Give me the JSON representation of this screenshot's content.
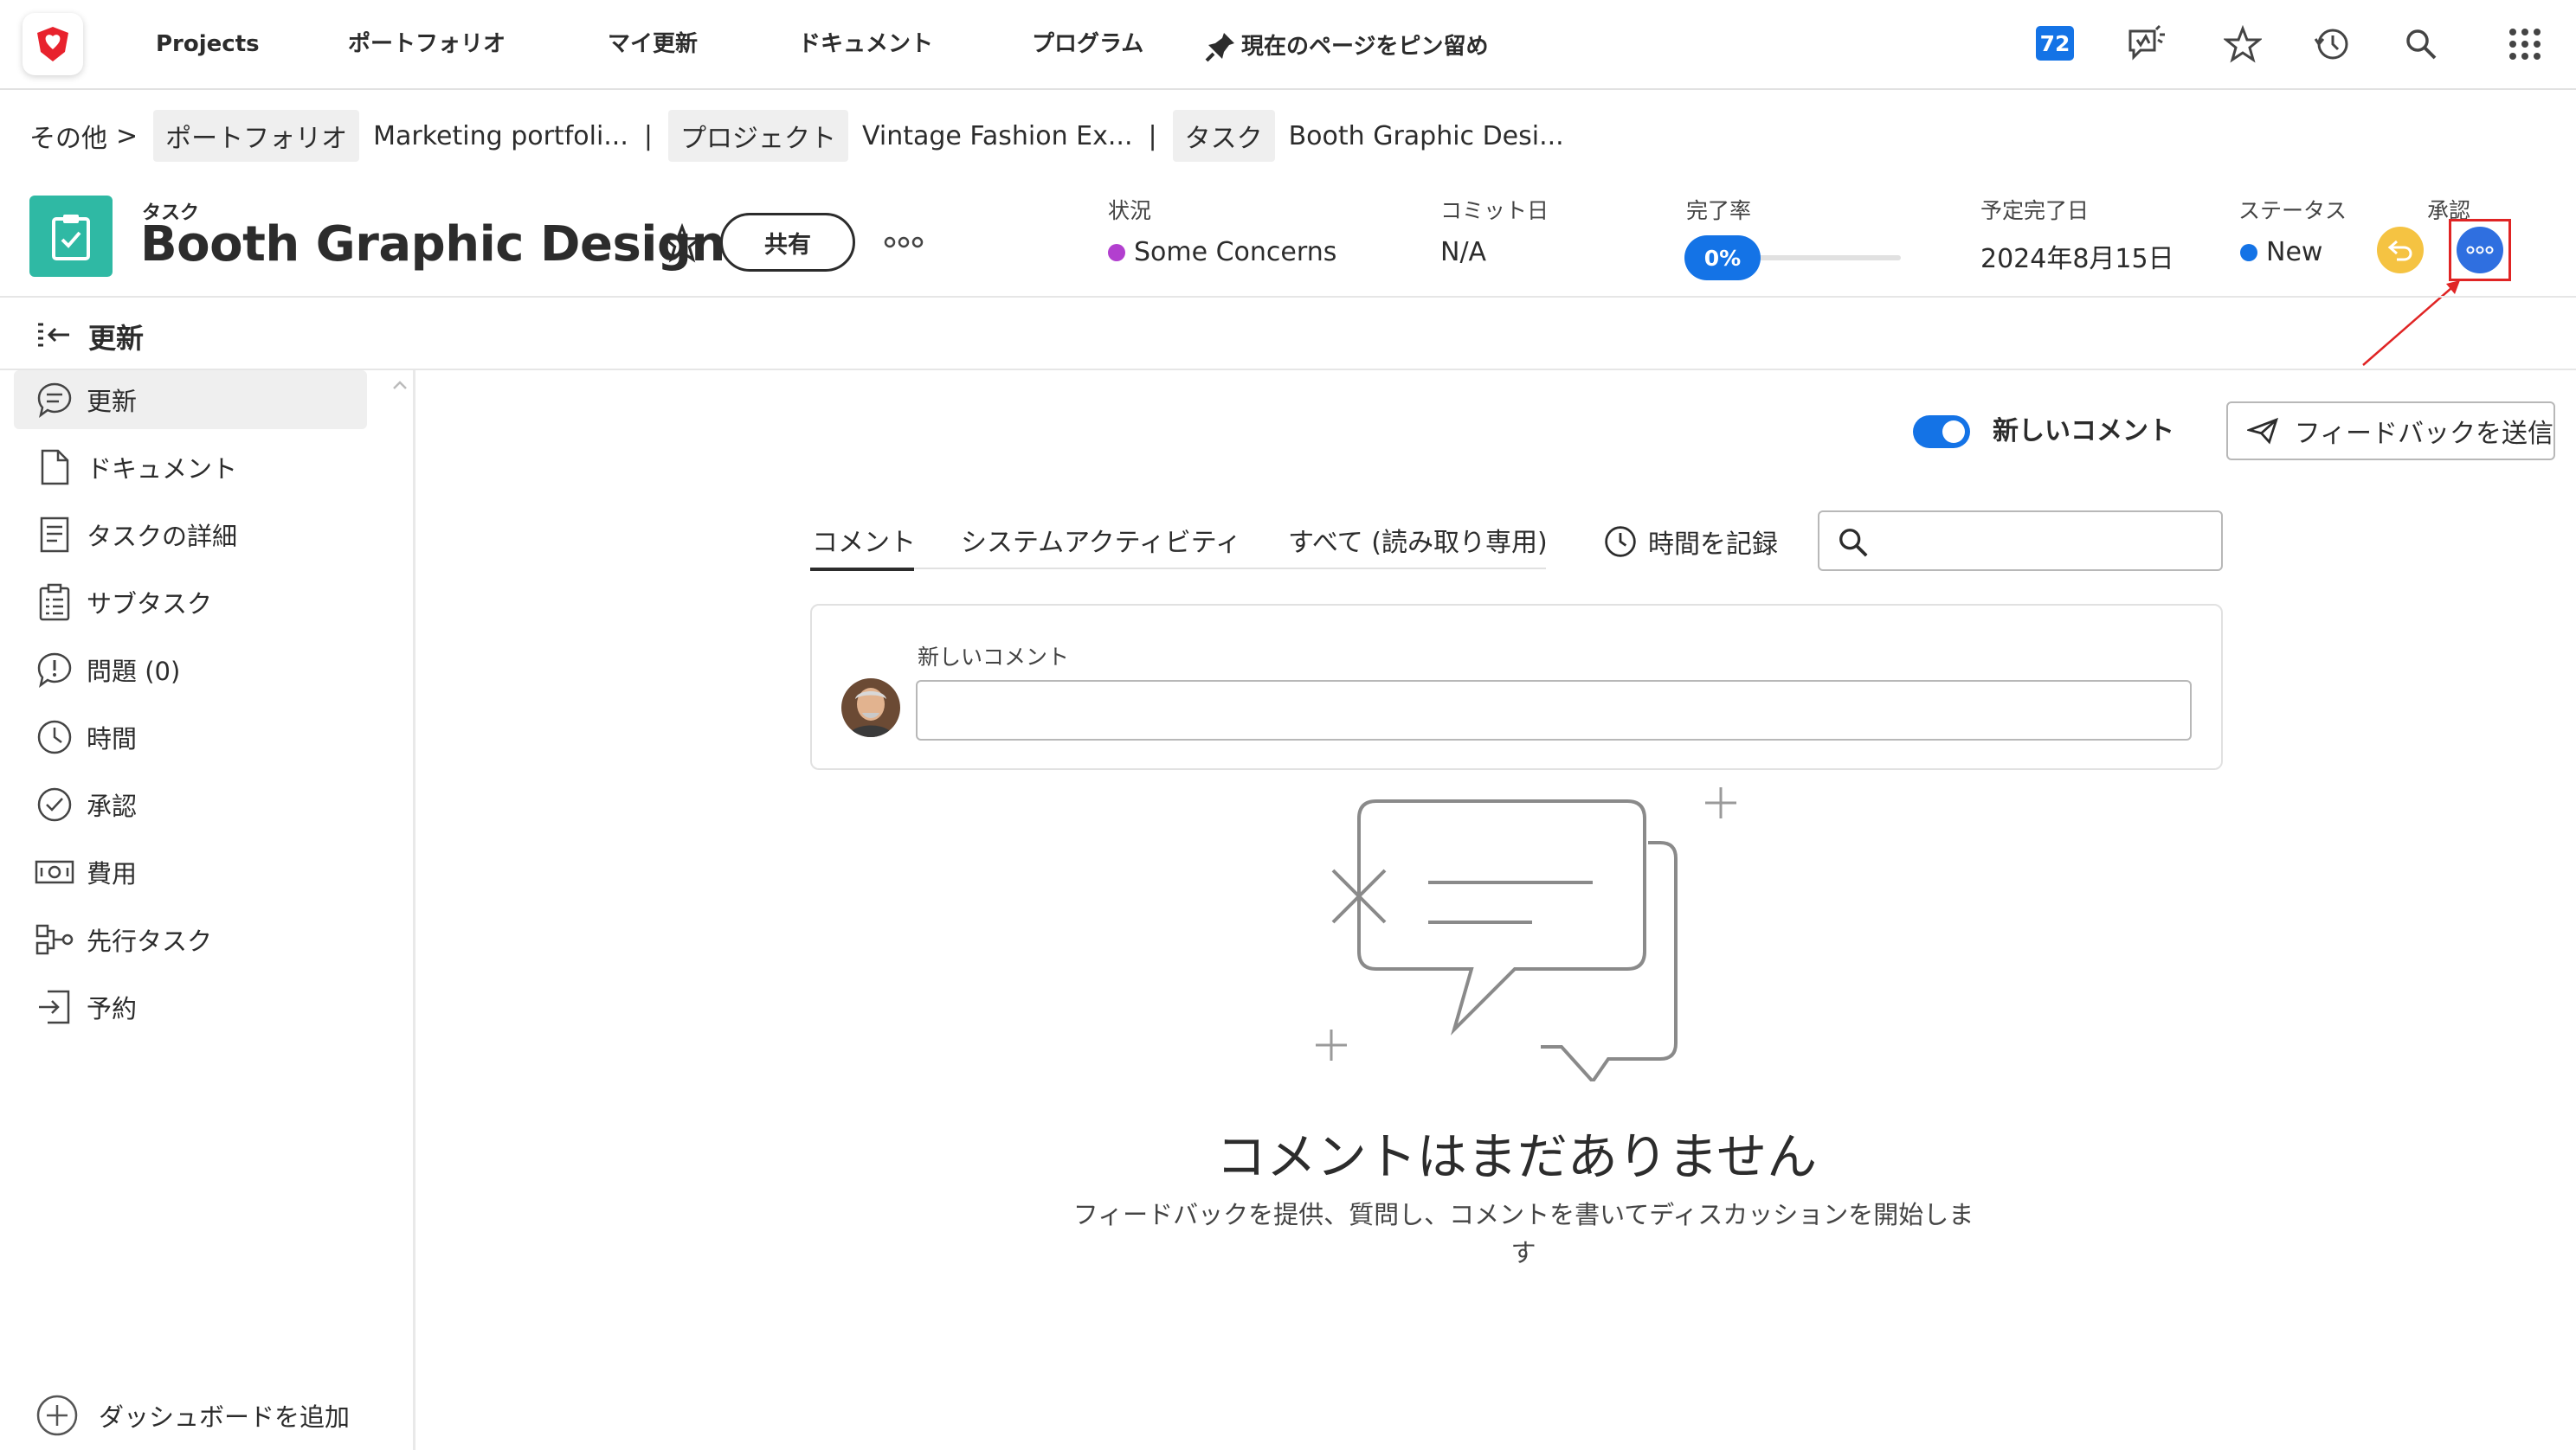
{
  "nav": {
    "items": [
      "Projects",
      "ポートフォリオ",
      "マイ更新",
      "ドキュメント",
      "プログラム",
      "現在のページをピン留め"
    ],
    "notification_count": "72"
  },
  "breadcrumb": {
    "root": "その他",
    "root_sep": ">",
    "portfolio_type": "ポートフォリオ",
    "portfolio_name": "Marketing portfoli...",
    "project_type": "プロジェクト",
    "project_name": "Vintage Fashion Ex...",
    "task_type": "タスク",
    "task_name": "Booth Graphic Desi...",
    "sep": "|"
  },
  "header": {
    "object_type": "タスク",
    "title": "Booth Graphic Design",
    "share_label": "共有",
    "fields": {
      "condition_label": "状況",
      "condition_value": "Some Concerns",
      "condition_color": "#b23fcf",
      "commit_label": "コミット日",
      "commit_value": "N/A",
      "percent_label": "完了率",
      "percent_value": "0%",
      "percent_complete": 0,
      "due_label": "予定完了日",
      "due_value": "2024年8月15日",
      "status_label": "ステータス",
      "status_value": "New",
      "status_color": "#1473e6",
      "approval_label": "承認"
    }
  },
  "panel": {
    "title": "更新"
  },
  "sidebar": {
    "items": [
      {
        "label": "更新",
        "icon": "comment-icon"
      },
      {
        "label": "ドキュメント",
        "icon": "document-icon"
      },
      {
        "label": "タスクの詳細",
        "icon": "details-icon"
      },
      {
        "label": "サブタスク",
        "icon": "subtask-icon"
      },
      {
        "label": "問題 (0)",
        "icon": "issue-icon"
      },
      {
        "label": "時間",
        "icon": "clock-icon"
      },
      {
        "label": "承認",
        "icon": "checkmark-circle-icon"
      },
      {
        "label": "費用",
        "icon": "money-icon"
      },
      {
        "label": "先行タスク",
        "icon": "predecessor-icon"
      },
      {
        "label": "予約",
        "icon": "booking-icon"
      }
    ],
    "add_dashboard": "ダッシュボードを追加"
  },
  "main": {
    "new_comment_toggle": "新しいコメント",
    "feedback_button": "フィードバックを送信",
    "tabs": [
      "コメント",
      "システムアクティビティ",
      "すべて (読み取り専用)"
    ],
    "log_time": "時間を記録",
    "search_placeholder": "",
    "comment_label": "新しいコメント",
    "comment_placeholder": "",
    "empty_title": "コメントはまだありません",
    "empty_desc": "フィードバックを提供、質問し、コメントを書いてディスカッションを開始します"
  },
  "colors": {
    "accent": "#1473e6",
    "task_icon": "#2fb9a4",
    "approval_undo": "#f5c342",
    "annotation": "#e02424"
  }
}
